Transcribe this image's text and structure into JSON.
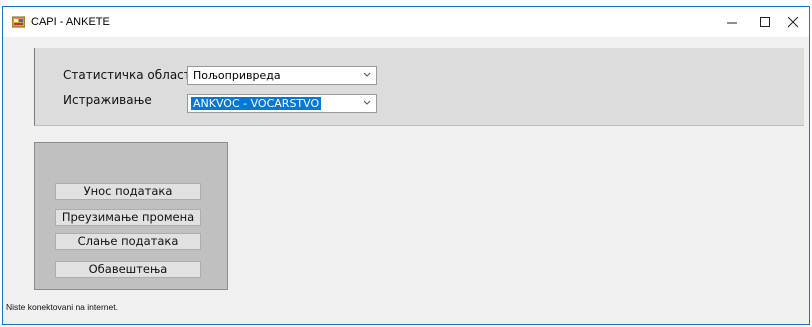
{
  "window": {
    "title": "CAPI - ANKETE",
    "controls": {
      "minimize": "—",
      "maximize": "☐",
      "close": "✕"
    }
  },
  "form": {
    "area_label": "Статистичка област",
    "area_value": "Пољопривреда",
    "survey_label": "Истраживање",
    "survey_value": "ANKVOC - VOCARSTVO"
  },
  "buttons": {
    "data_entry": "Унос података",
    "download_changes": "Преузимање промена",
    "send_data": "Слање података",
    "notifications": "Обавештења"
  },
  "status_text": "Niste konektovani na internet.",
  "icons": [
    "app-icon",
    "chevron-down-icon"
  ],
  "colors": {
    "accent": "#0078d7",
    "window_border": "#1a73c6",
    "panel": "#dcdcdc",
    "button_panel": "#c0c0c0"
  }
}
